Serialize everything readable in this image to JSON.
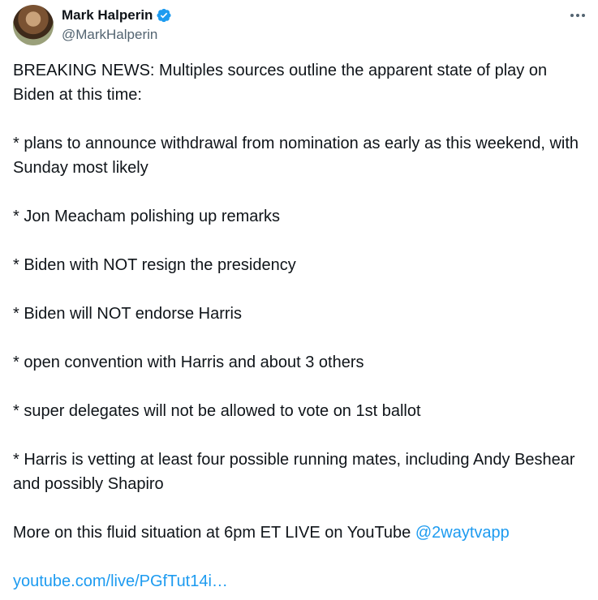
{
  "author": {
    "name": "Mark Halperin",
    "handle": "@MarkHalperin",
    "verified": true,
    "verified_color": "#1d9bf0",
    "avatar_icon": "avatar"
  },
  "more_icon": "more-horizontal-icon",
  "tweet": {
    "intro": "BREAKING NEWS: Multiples sources outline the apparent state of play on Biden at this time:",
    "bullets": [
      "* plans to announce withdrawal from nomination as early as this weekend, with Sunday most likely",
      "* Jon Meacham polishing up remarks",
      "* Biden with NOT resign the presidency",
      "* Biden will NOT endorse Harris",
      "* open convention with Harris and about 3 others",
      "* super delegates will not be allowed to vote on 1st ballot",
      "* Harris is vetting at least four possible running mates, including Andy Beshear and possibly Shapiro"
    ],
    "closing_prefix": "More on this fluid situation at 6pm ET LIVE on YouTube ",
    "mention": "@2waytvapp",
    "link": "youtube.com/live/PGfTut14i…"
  },
  "colors": {
    "text": "#0f1419",
    "secondary": "#536471",
    "accent": "#1d9bf0"
  }
}
